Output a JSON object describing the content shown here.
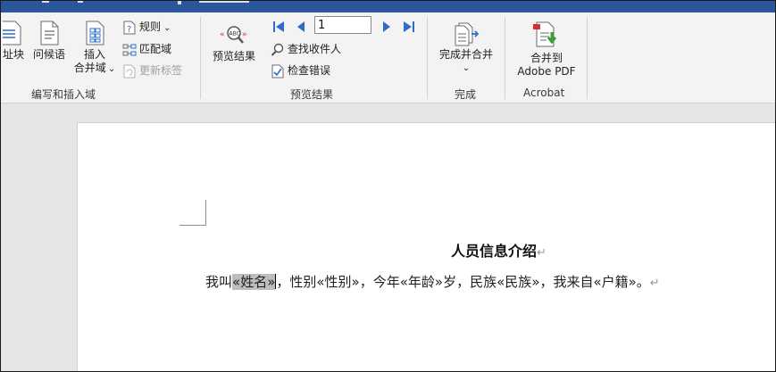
{
  "ribbon": {
    "write_insert": {
      "address_block_label": "址块",
      "greeting_label": "问候语",
      "insert_field_line1": "插入",
      "insert_field_line2": "合并域",
      "rules_label": "规则",
      "match_fields_label": "匹配域",
      "update_labels_label": "更新标签",
      "group_label": "编写和插入域"
    },
    "preview": {
      "preview_results_label": "预览结果",
      "record_value": "1",
      "find_recipient_label": "查找收件人",
      "check_errors_label": "检查错误",
      "group_label": "预览结果"
    },
    "finish": {
      "finish_merge_label": "完成并合并",
      "group_label": "完成"
    },
    "acrobat": {
      "merge_to_line1": "合并到",
      "merge_to_line2": "Adobe PDF",
      "group_label": "Acrobat"
    },
    "dropdown_arrow": "⌄"
  },
  "document": {
    "title": "人员信息介绍",
    "paragraph_mark": "↵",
    "line": {
      "text_before": "我叫",
      "field_name": "«姓名»",
      "text_rest": "，性别«性别»，今年«年龄»岁，民族«民族»，我来自«户籍»。"
    }
  },
  "colors": {
    "title_bar": "#2b579a",
    "ribbon_bg": "#f3f3f3",
    "nav_blue": "#2e6cc8",
    "workspace_bg": "#e6e6e6",
    "field_highlight": "#bdbdbd"
  }
}
